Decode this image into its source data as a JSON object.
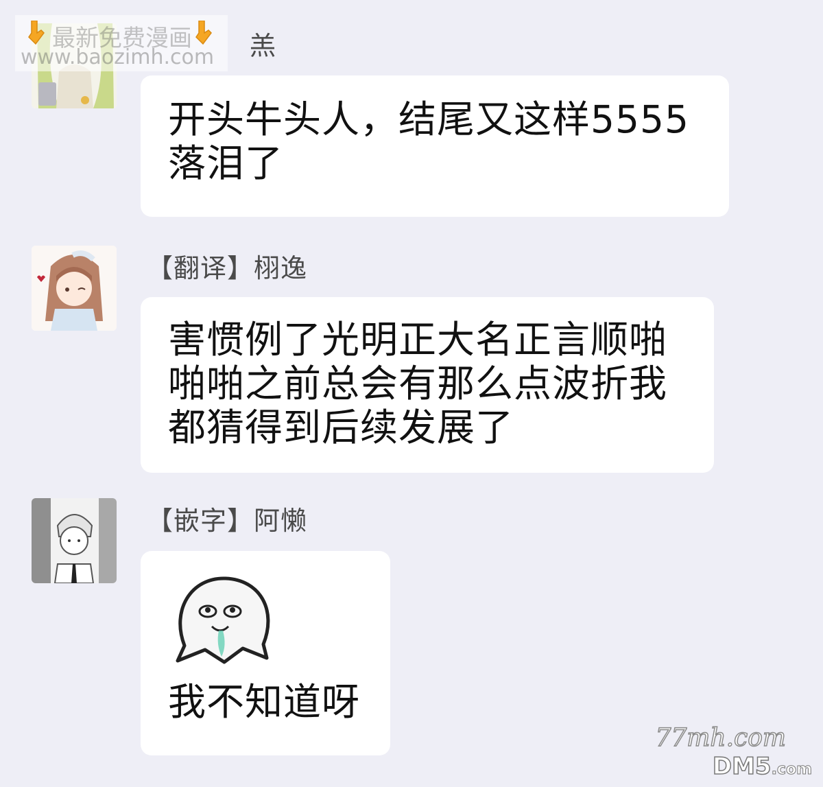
{
  "watermark": {
    "title": "最新免费漫画",
    "url": "www.baozimh.com",
    "hand_icon": "pointing-down-hand"
  },
  "messages": [
    {
      "sender": "羔",
      "lines": [
        "开头牛头人，结尾又这样5555",
        "落泪了"
      ]
    },
    {
      "sender": "【翻译】栩逸",
      "lines": [
        "害惯例了光明正大名正言顺啪",
        "啪啪之前总会有那么点波折我",
        "都猜得到后续发展了"
      ]
    },
    {
      "sender": "【嵌字】阿懒",
      "sticker_caption": "我不知道呀"
    }
  ],
  "corner_watermark": {
    "site": "77mh.com",
    "brand": "DM5",
    "suffix": ".com"
  },
  "colors": {
    "background": "#eeeef6",
    "bubble": "#ffffff",
    "sender_text": "#4a4a4a",
    "message_text": "#111111"
  }
}
